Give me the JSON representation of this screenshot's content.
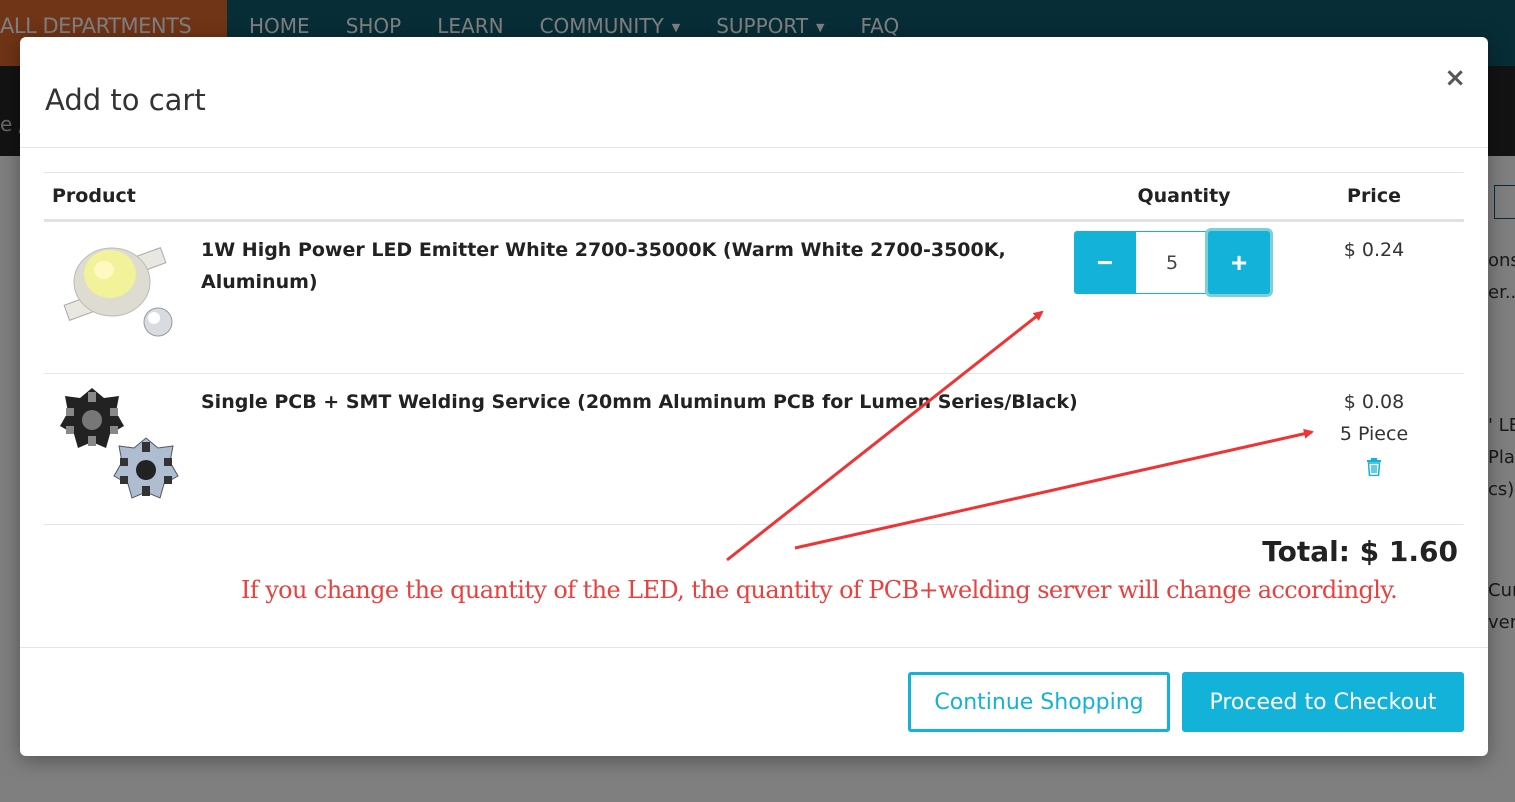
{
  "background": {
    "department_menu": "ALL DEPARTMENTS",
    "nav": [
      {
        "label": "HOME",
        "dropdown": false
      },
      {
        "label": "SHOP",
        "dropdown": false
      },
      {
        "label": "LEARN",
        "dropdown": false
      },
      {
        "label": "COMMUNITY",
        "dropdown": true
      },
      {
        "label": "SUPPORT",
        "dropdown": true
      },
      {
        "label": "FAQ",
        "dropdown": false
      }
    ],
    "breadcrumb_fragment": "e /",
    "side_fragments": [
      "ons",
      "er...",
      "' LE",
      "Plat",
      "cs)",
      "Cur",
      "ver"
    ]
  },
  "modal": {
    "title": "Add to cart",
    "close_icon": "×",
    "columns": {
      "product": "Product",
      "quantity": "Quantity",
      "price": "Price"
    },
    "items": [
      {
        "name": "1W High Power LED Emitter White 2700-35000K (Warm White 2700-3500K, Aluminum)",
        "image": "led-emitter-image",
        "quantity": "5",
        "price": "$ 0.24"
      },
      {
        "name": "Single PCB + SMT Welding Service (20mm Aluminum PCB for Lumen Series/Black)",
        "image": "star-pcb-image",
        "price": "$ 0.08",
        "quantity_text": "5 Piece",
        "delete_icon": "trash-icon"
      }
    ],
    "stepper": {
      "minus": "−",
      "plus": "+"
    },
    "total": "Total: $ 1.60",
    "annotation": "If you change the quantity of the LED, the quantity of PCB+welding server will change accordingly.",
    "buttons": {
      "continue": "Continue Shopping",
      "checkout": "Proceed to Checkout"
    },
    "colors": {
      "accent": "#13b2d8",
      "annotation": "#e8413e",
      "nav_bg": "#0e5a6e",
      "dept_bg": "#e0692c"
    }
  }
}
